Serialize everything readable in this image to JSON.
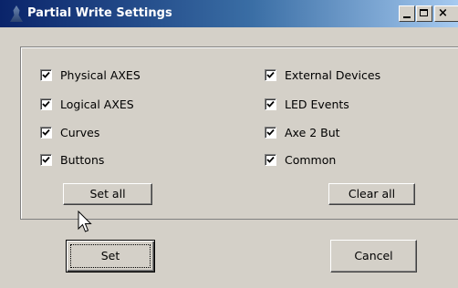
{
  "window": {
    "title": "Partial Write Settings",
    "controls": {
      "minimize": "minimize",
      "maximize": "maximize",
      "close": "×"
    }
  },
  "checkboxes": {
    "left": [
      {
        "label": "Physical AXES",
        "checked": true
      },
      {
        "label": "Logical AXES",
        "checked": true
      },
      {
        "label": "Curves",
        "checked": true
      },
      {
        "label": "Buttons",
        "checked": true
      }
    ],
    "right": [
      {
        "label": "External Devices",
        "checked": true
      },
      {
        "label": "LED Events",
        "checked": true
      },
      {
        "label": "Axe 2 But",
        "checked": true
      },
      {
        "label": "Common",
        "checked": true
      }
    ]
  },
  "buttons": {
    "set_all": "Set all",
    "clear_all": "Clear all",
    "set": "Set",
    "cancel": "Cancel"
  },
  "colors": {
    "title_gradient_start": "#0a246a",
    "title_gradient_end": "#a6caf0",
    "face": "#d4d0c8"
  }
}
